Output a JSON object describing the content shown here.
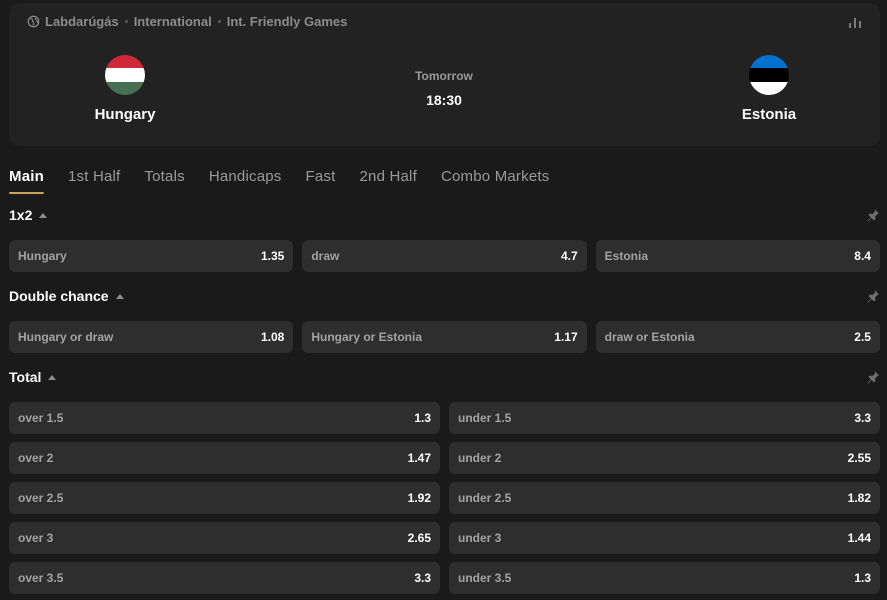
{
  "breadcrumb": {
    "items": [
      "Labdarúgás",
      "International",
      "Int. Friendly Games"
    ]
  },
  "match": {
    "home": {
      "name": "Hungary",
      "flag_colors": [
        "#ce2939",
        "#ffffff",
        "#477050"
      ]
    },
    "away": {
      "name": "Estonia",
      "flag_colors": [
        "#0072ce",
        "#000000",
        "#ffffff"
      ]
    },
    "day": "Tomorrow",
    "time": "18:30"
  },
  "tabs": [
    {
      "label": "Main",
      "active": true
    },
    {
      "label": "1st Half",
      "active": false
    },
    {
      "label": "Totals",
      "active": false
    },
    {
      "label": "Handicaps",
      "active": false
    },
    {
      "label": "Fast",
      "active": false
    },
    {
      "label": "2nd Half",
      "active": false
    },
    {
      "label": "Combo Markets",
      "active": false
    }
  ],
  "markets": {
    "x12": {
      "title": "1x2",
      "odds": [
        {
          "label": "Hungary",
          "value": "1.35"
        },
        {
          "label": "draw",
          "value": "4.7"
        },
        {
          "label": "Estonia",
          "value": "8.4"
        }
      ]
    },
    "double_chance": {
      "title": "Double chance",
      "odds": [
        {
          "label": "Hungary or draw",
          "value": "1.08"
        },
        {
          "label": "Hungary or Estonia",
          "value": "1.17"
        },
        {
          "label": "draw or Estonia",
          "value": "2.5"
        }
      ]
    },
    "total": {
      "title": "Total",
      "rows": [
        [
          {
            "label": "over 1.5",
            "value": "1.3"
          },
          {
            "label": "under 1.5",
            "value": "3.3"
          }
        ],
        [
          {
            "label": "over 2",
            "value": "1.47"
          },
          {
            "label": "under 2",
            "value": "2.55"
          }
        ],
        [
          {
            "label": "over 2.5",
            "value": "1.92"
          },
          {
            "label": "under 2.5",
            "value": "1.82"
          }
        ],
        [
          {
            "label": "over 3",
            "value": "2.65"
          },
          {
            "label": "under 3",
            "value": "1.44"
          }
        ],
        [
          {
            "label": "over 3.5",
            "value": "3.3"
          },
          {
            "label": "under 3.5",
            "value": "1.3"
          }
        ]
      ]
    }
  },
  "colors": {
    "background": "#1a1a1a",
    "card": "#222222",
    "odd_button": "#2e2e2e",
    "accent": "#c9a45a"
  }
}
